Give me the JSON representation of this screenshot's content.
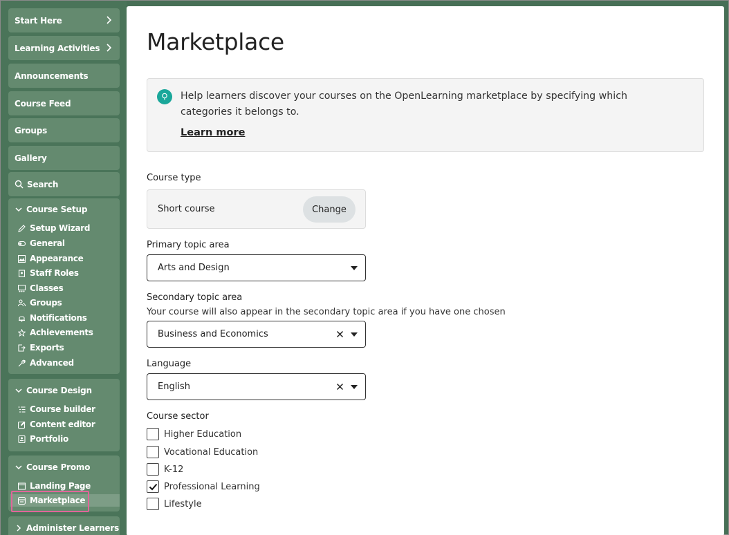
{
  "sidebar": {
    "top_items": [
      {
        "label": "Start Here"
      },
      {
        "label": "Learning Activities"
      },
      {
        "label": "Announcements"
      },
      {
        "label": "Course Feed"
      },
      {
        "label": "Groups"
      },
      {
        "label": "Gallery"
      },
      {
        "label": "Search"
      }
    ],
    "course_setup": {
      "title": "Course Setup",
      "items": [
        "Setup Wizard",
        "General",
        "Appearance",
        "Staff Roles",
        "Classes",
        "Groups",
        "Notifications",
        "Achievements",
        "Exports",
        "Advanced"
      ]
    },
    "course_design": {
      "title": "Course Design",
      "items": [
        "Course builder",
        "Content editor",
        "Portfolio"
      ]
    },
    "course_promo": {
      "title": "Course Promo",
      "items": [
        "Landing Page",
        "Marketplace"
      ]
    },
    "administer": {
      "title": "Administer Learners"
    }
  },
  "main": {
    "title": "Marketplace",
    "info": {
      "text": "Help learners discover your courses on the OpenLearning marketplace by specifying which categories it belongs to.",
      "link": "Learn more"
    },
    "course_type": {
      "label": "Course type",
      "value": "Short course",
      "button": "Change"
    },
    "primary_topic": {
      "label": "Primary topic area",
      "value": "Arts and Design"
    },
    "secondary_topic": {
      "label": "Secondary topic area",
      "help": "Your course will also appear in the secondary topic area if you have one chosen",
      "value": "Business and Economics"
    },
    "language": {
      "label": "Language",
      "value": "English"
    },
    "course_sector": {
      "label": "Course sector",
      "options": [
        {
          "label": "Higher Education",
          "checked": false
        },
        {
          "label": "Vocational Education",
          "checked": false
        },
        {
          "label": "K-12",
          "checked": false
        },
        {
          "label": "Professional Learning",
          "checked": true
        },
        {
          "label": "Lifestyle",
          "checked": false
        }
      ]
    }
  },
  "colors": {
    "sidebar_bg": "#476f56",
    "nav_item": "#648a6f",
    "accent": "#1aa79a",
    "highlight": "#e0669a"
  }
}
